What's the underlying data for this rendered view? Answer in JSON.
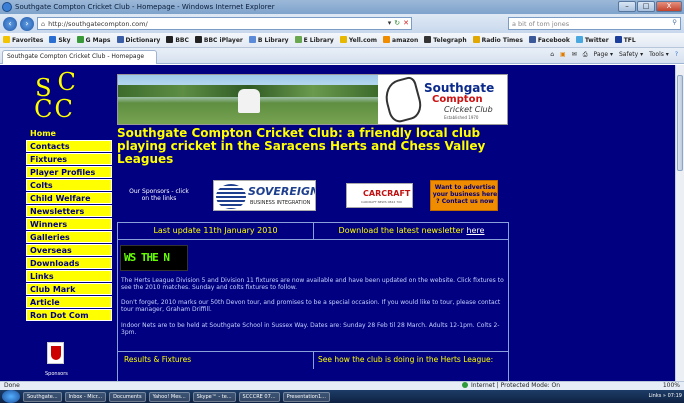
{
  "window": {
    "title": "Southgate Compton Cricket Club - Homepage - Windows Internet Explorer",
    "controls": [
      "–",
      "□",
      "X"
    ]
  },
  "address_bar": {
    "url": "http://southgatecompton.com/",
    "search_placeholder": "a bit of tom jones"
  },
  "favorites_bar": {
    "items": [
      "Favorites",
      "Sky",
      "G Maps",
      "Dictionary",
      "BBC",
      "BBC iPlayer",
      "B Library",
      "E Library",
      "Yell.com",
      "amazon",
      "Telegraph",
      "Radio Times",
      "Facebook",
      "Twitter",
      "TFL"
    ]
  },
  "tab": {
    "label": "Southgate Compton Cricket Club - Homepage"
  },
  "command_bar": {
    "items": [
      "Page ▾",
      "Safety ▾",
      "Tools ▾"
    ]
  },
  "site": {
    "logo_text": "SC CC",
    "menu_home": "Home",
    "menu": [
      "Contacts",
      "Fixtures",
      "Player Profiles",
      "Colts",
      "Child Welfare",
      "Newsletters",
      "Winners",
      "Galleries",
      "Overseas",
      "Downloads",
      "Links",
      "Club Mark",
      "Article",
      "Ron Dot Com"
    ],
    "banner": {
      "club_line1": "Southgate",
      "club_line2": "Compton",
      "club_line3": "Cricket Club",
      "club_line4": "Established 1970"
    },
    "headline": "Southgate Compton Cricket Club: a friendly local club playing cricket in the Saracens Herts and Chess Valley Leagues",
    "sponsors_label": "Our Sponsors - click on the links",
    "sponsors": {
      "sovereign_name": "SOVEREIGN",
      "sovereign_sub": "BUSINESS INTEGRATION",
      "carcraft_name": "CARCRAFT",
      "carcraft_sub": "CARCRAFT NEWS 0844 700",
      "advertise_text": "Want to advertise your business here ? Contact us now"
    },
    "last_update": "Last update 11th January 2010",
    "newsletter_text": "Download the latest newsletter ",
    "newsletter_link": "here",
    "news_ticker": "WS THE N",
    "paragraphs": [
      "The Herts League Division 5 and Division 11 fixtures are now available and have been updated on the website. Click fixtures to see the 2010 matches. Sunday and colts fixtures to follow.",
      "Don't forget, 2010 marks our 50th Devon tour, and promises to be a special occasion. If you would like to tour, please contact tour manager, Graham Driffill.",
      "Indoor Nets are to be held at Southgate School in Sussex Way. Dates are: Sunday 28 Feb til 28 March. Adults 12-1pm. Colts 2-3pm."
    ],
    "results_label": "Results & Fixtures",
    "league_label": "See how the club is doing in the Herts League:",
    "sponsors_small": "Sponsors"
  },
  "status_bar": {
    "left": "Done",
    "zone": "Internet | Protected Mode: On",
    "zoom": "100%"
  },
  "taskbar": {
    "items": [
      "Southgate...",
      "Inbox - Micr...",
      "Documents",
      "Yahoo! Mes...",
      "Skype™ - te...",
      "SCCCRE 07...",
      "Presentation1..."
    ],
    "tray": "Links » 07:19"
  }
}
